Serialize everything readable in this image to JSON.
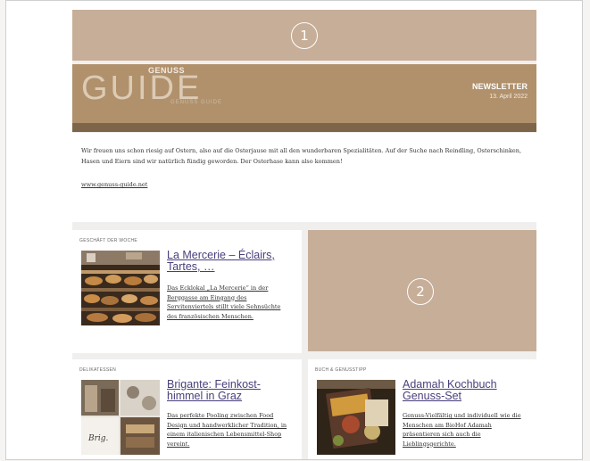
{
  "placeholders": {
    "first": "1",
    "second": "2"
  },
  "header": {
    "logo_main": "GUIDE",
    "logo_top": "GENUSS",
    "logo_bottom": "GENUSS GUIDE",
    "title": "NEWSLETTER",
    "date": "13. April 2022"
  },
  "intro": {
    "text": "Wir freuen uns schon riesig auf Ostern, also auf die Osterjause mit all den wunderbaren Spezialitäten. Auf der Suche nach Reindling, Osterschinken, Hasen und Eiern sind wir natürlich fündig geworden. Der Osterhase kann also kommen!",
    "link": "www.genuss-guide.net"
  },
  "cards": [
    {
      "category": "GESCHÄFT DER WOCHE",
      "title": "La Mercerie – Éclairs, Tartes, …",
      "description": "Das Ecklokal „La Mercerie“ in der Berggasse am Eingang des Servitenviertels stillt viele Sehnsüchte des französischen Menschen."
    },
    {
      "category": "DELIKATESSEN",
      "title": "Brigante: Feinkost-himmel in Graz",
      "description": "Das perfekte Pooling zwischen Food Design und handwerklicher Tradition, in einem italienischen Lebensmittel-Shop vereint."
    },
    {
      "category": "BUCH & GENUSSTIPP",
      "title": "Adamah Kochbuch Genuss-Set",
      "description": "Genuss-Vielfältig und individuell wie die Menschen am BioHof Adamah präsentieren sich auch die Lieblingsgerichte."
    }
  ],
  "colors": {
    "placeholder": "#c7ae98",
    "header_bg": "#b0916c",
    "header_stripe": "#7d6549",
    "link": "#4a3e7a"
  }
}
